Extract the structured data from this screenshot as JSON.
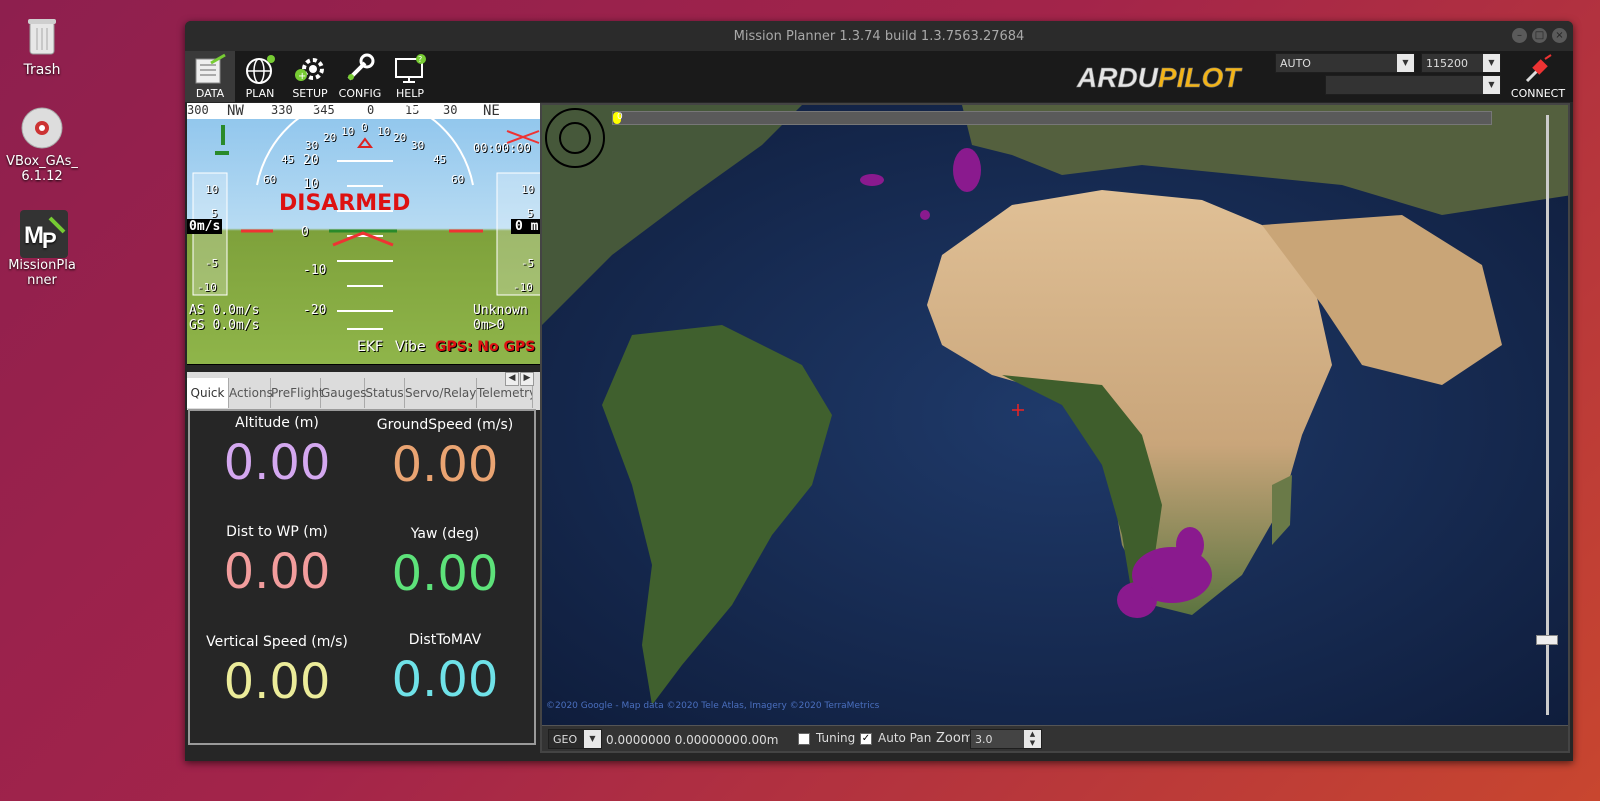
{
  "desktop": {
    "icons": [
      {
        "label": "Trash"
      },
      {
        "label": "VBox_GAs_\n6.1.12"
      },
      {
        "label": "MissionPla\nnner"
      }
    ]
  },
  "window": {
    "title": "Mission Planner 1.3.74 build 1.3.7563.27684"
  },
  "toolbar": {
    "buttons": [
      {
        "label": "DATA",
        "icon": "data-icon"
      },
      {
        "label": "PLAN",
        "icon": "globe-icon"
      },
      {
        "label": "SETUP",
        "icon": "gear-icon"
      },
      {
        "label": "CONFIG",
        "icon": "wrench-icon"
      },
      {
        "label": "HELP",
        "icon": "monitor-help-icon"
      }
    ],
    "logo": "ARDUPILOT",
    "mode": "AUTO",
    "baud": "115200",
    "port": "",
    "connect_label": "CONNECT"
  },
  "hud": {
    "heading_ticks": [
      "300",
      "NW",
      "330",
      "345",
      "0",
      "15",
      "30",
      "NE"
    ],
    "status": "DISARMED",
    "left_speed": "0m/s",
    "right_alt": "0 m",
    "speed_tape": [
      "10",
      "5",
      "0",
      "-5",
      "-10"
    ],
    "alt_tape": [
      "10",
      "5",
      "0",
      "-5",
      "-10"
    ],
    "pitch_labels": [
      "20",
      "10",
      "0",
      "-10",
      "-20"
    ],
    "roll_labels": [
      "60",
      "45",
      "30",
      "20",
      "10",
      "0",
      "10",
      "20",
      "30",
      "45",
      "60"
    ],
    "airspeed": "AS 0.0m/s",
    "groundspeed": "GS 0.0m/s",
    "timer": "00:00:00",
    "mode_status": "Unknown",
    "wp_status": "0m>0",
    "ekf": "EKF",
    "vibe": "Vibe",
    "gps": "GPS: No GPS"
  },
  "tabs": [
    "Quick",
    "Actions",
    "PreFlight",
    "Gauges",
    "Status",
    "Servo/Relay",
    "Telemetry"
  ],
  "quick": [
    {
      "label": "Altitude (m)",
      "value": "0.00",
      "color": "#d4a8f0"
    },
    {
      "label": "GroundSpeed (m/s)",
      "value": "0.00",
      "color": "#eaa472"
    },
    {
      "label": "Dist to WP (m)",
      "value": "0.00",
      "color": "#f29d9d"
    },
    {
      "label": "Yaw (deg)",
      "value": "0.00",
      "color": "#5de27a"
    },
    {
      "label": "Vertical Speed (m/s)",
      "value": "0.00",
      "color": "#ecec9a"
    },
    {
      "label": "DistToMAV",
      "value": "0.00",
      "color": "#6fe2e8"
    }
  ],
  "map": {
    "copyright": "©2020 Google - Map data ©2020 Tele Atlas, Imagery ©2020 TerraMetrics",
    "coord_system": "GEO",
    "lat_lng": "0.0000000 0.0000000",
    "alt": "0.00m",
    "tuning_label": "Tuning",
    "tuning_checked": false,
    "autopan_label": "Auto Pan",
    "autopan_checked": true,
    "zoom_label": "Zoom",
    "zoom_value": "3.0",
    "slider_level": "0"
  }
}
